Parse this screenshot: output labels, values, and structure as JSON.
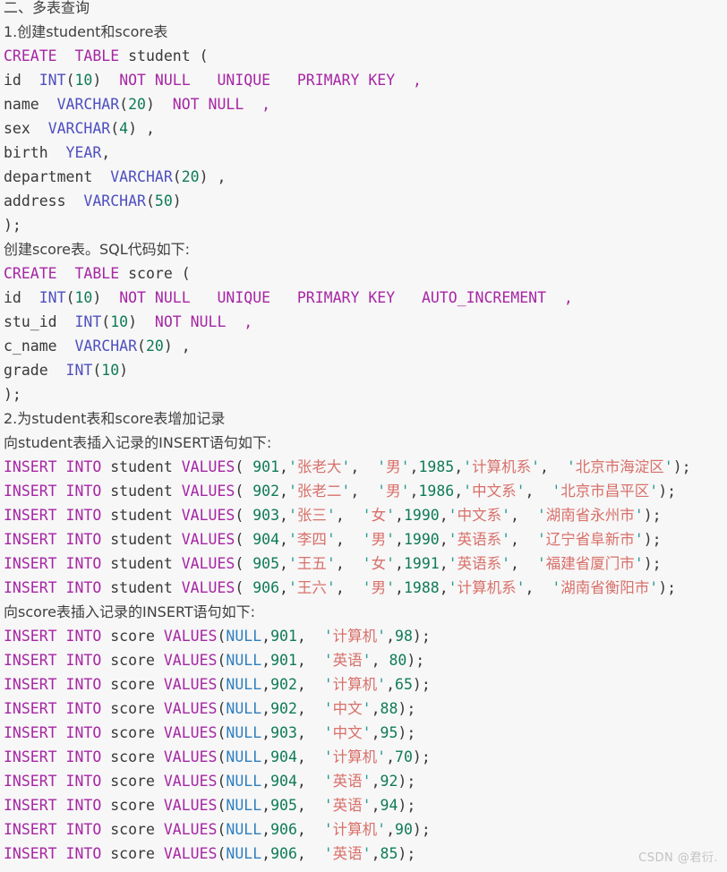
{
  "document": {
    "section_heading": "二、多表查询",
    "subsection_1": "1.创建student和score表",
    "note_create_score": "创建score表。SQL代码如下:",
    "subsection_2": "2.为student表和score表增加记录",
    "note_insert_student": "向student表插入记录的INSERT语句如下:",
    "note_insert_score": "向score表插入记录的INSERT语句如下:"
  },
  "watermark": {
    "text": "CSDN @君衍."
  },
  "colors": {
    "background": "#f7f7f7",
    "keyword": "#a626a4",
    "type": "#4f4fbf",
    "identifier": "#383838",
    "number": "#0f7b55",
    "string": "#d8706a",
    "quote": "#2a9a8f",
    "null_literal": "#2f7fbf",
    "prose": "#3f3f3f",
    "watermark": "#c2c2c2"
  },
  "code": {
    "create_student": {
      "line_1_kw_create": "CREATE",
      "line_1_kw_table": "TABLE",
      "line_1_name": "student",
      "line_1_paren": "(",
      "col_id_name": "id",
      "col_id_type": "INT",
      "col_id_len": "10",
      "col_id_constraints": "NOT NULL   UNIQUE   PRIMARY KEY  ,",
      "col_name_name": "name",
      "col_name_type": "VARCHAR",
      "col_name_len": "20",
      "col_name_constraints": "NOT NULL  ,",
      "col_sex_name": "sex",
      "col_sex_type": "VARCHAR",
      "col_sex_len": "4",
      "col_sex_tail": ",",
      "col_birth_name": "birth",
      "col_birth_type": "YEAR",
      "col_birth_tail": ",",
      "col_department_name": "department",
      "col_department_type": "VARCHAR",
      "col_department_len": "20",
      "col_department_tail": ",",
      "col_address_name": "address",
      "col_address_type": "VARCHAR",
      "col_address_len": "50",
      "close": ");"
    },
    "create_score": {
      "line_1_kw_create": "CREATE",
      "line_1_kw_table": "TABLE",
      "line_1_name": "score",
      "line_1_paren": "(",
      "col_id_name": "id",
      "col_id_type": "INT",
      "col_id_len": "10",
      "col_id_constraints": "NOT NULL   UNIQUE   PRIMARY KEY   AUTO_INCREMENT  ,",
      "col_stuid_name": "stu_id",
      "col_stuid_type": "INT",
      "col_stuid_len": "10",
      "col_stuid_constraints": "NOT NULL  ,",
      "col_cname_name": "c_name",
      "col_cname_type": "VARCHAR",
      "col_cname_len": "20",
      "col_cname_tail": ",",
      "col_grade_name": "grade",
      "col_grade_type": "INT",
      "col_grade_len": "10",
      "close": ");"
    },
    "insert_prefix_student": {
      "kw_insert": "INSERT",
      "kw_into": "INTO",
      "table": "student",
      "kw_values": "VALUES"
    },
    "insert_prefix_score": {
      "kw_insert": "INSERT",
      "kw_into": "INTO",
      "table": "score",
      "kw_values": "VALUES"
    }
  },
  "student_rows": [
    {
      "id": "901",
      "name": "张老大",
      "sex": "男",
      "birth": "1985",
      "department": "计算机系",
      "address": "北京市海淀区"
    },
    {
      "id": "902",
      "name": "张老二",
      "sex": "男",
      "birth": "1986",
      "department": "中文系",
      "address": "北京市昌平区"
    },
    {
      "id": "903",
      "name": "张三",
      "sex": "女",
      "birth": "1990",
      "department": "中文系",
      "address": "湖南省永州市"
    },
    {
      "id": "904",
      "name": "李四",
      "sex": "男",
      "birth": "1990",
      "department": "英语系",
      "address": "辽宁省阜新市"
    },
    {
      "id": "905",
      "name": "王五",
      "sex": "女",
      "birth": "1991",
      "department": "英语系",
      "address": "福建省厦门市"
    },
    {
      "id": "906",
      "name": "王六",
      "sex": "男",
      "birth": "1988",
      "department": "计算机系",
      "address": "湖南省衡阳市"
    }
  ],
  "score_rows": [
    {
      "id": "NULL",
      "stu_id": "901",
      "c_name": "计算机",
      "grade": "98",
      "grade_space": ""
    },
    {
      "id": "NULL",
      "stu_id": "901",
      "c_name": "英语",
      "grade": "80",
      "grade_space": " "
    },
    {
      "id": "NULL",
      "stu_id": "902",
      "c_name": "计算机",
      "grade": "65",
      "grade_space": ""
    },
    {
      "id": "NULL",
      "stu_id": "902",
      "c_name": "中文",
      "grade": "88",
      "grade_space": ""
    },
    {
      "id": "NULL",
      "stu_id": "903",
      "c_name": "中文",
      "grade": "95",
      "grade_space": ""
    },
    {
      "id": "NULL",
      "stu_id": "904",
      "c_name": "计算机",
      "grade": "70",
      "grade_space": ""
    },
    {
      "id": "NULL",
      "stu_id": "904",
      "c_name": "英语",
      "grade": "92",
      "grade_space": ""
    },
    {
      "id": "NULL",
      "stu_id": "905",
      "c_name": "英语",
      "grade": "94",
      "grade_space": ""
    },
    {
      "id": "NULL",
      "stu_id": "906",
      "c_name": "计算机",
      "grade": "90",
      "grade_space": ""
    },
    {
      "id": "NULL",
      "stu_id": "906",
      "c_name": "英语",
      "grade": "85",
      "grade_space": ""
    }
  ]
}
